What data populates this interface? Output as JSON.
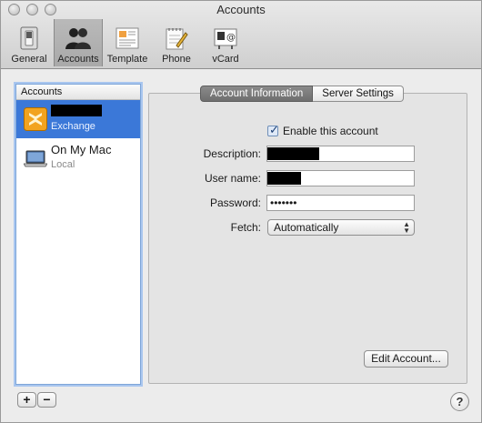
{
  "window": {
    "title": "Accounts"
  },
  "toolbar": {
    "items": [
      {
        "label": "General",
        "icon": "switch-icon"
      },
      {
        "label": "Accounts",
        "icon": "people-icon",
        "selected": true
      },
      {
        "label": "Template",
        "icon": "template-icon"
      },
      {
        "label": "Phone",
        "icon": "notepad-icon"
      },
      {
        "label": "vCard",
        "icon": "vcard-icon"
      }
    ]
  },
  "accounts": {
    "header": "Accounts",
    "items": [
      {
        "name": "",
        "type": "Exchange",
        "icon": "exchange-icon",
        "selected": true
      },
      {
        "name": "On My Mac",
        "type": "Local",
        "icon": "laptop-icon"
      }
    ]
  },
  "tabs": {
    "account_info": "Account Information",
    "server_settings": "Server Settings"
  },
  "form": {
    "enable_label": "Enable this account",
    "enabled": true,
    "description_label": "Description:",
    "description_value": "",
    "username_label": "User name:",
    "username_value": "",
    "password_label": "Password:",
    "password_value": "•••••••",
    "fetch_label": "Fetch:",
    "fetch_value": "Automatically"
  },
  "buttons": {
    "edit_account": "Edit Account...",
    "add": "+",
    "remove": "−",
    "help": "?"
  },
  "colors": {
    "selection": "#3b78d8",
    "tab_active": "#7a7a7a"
  }
}
